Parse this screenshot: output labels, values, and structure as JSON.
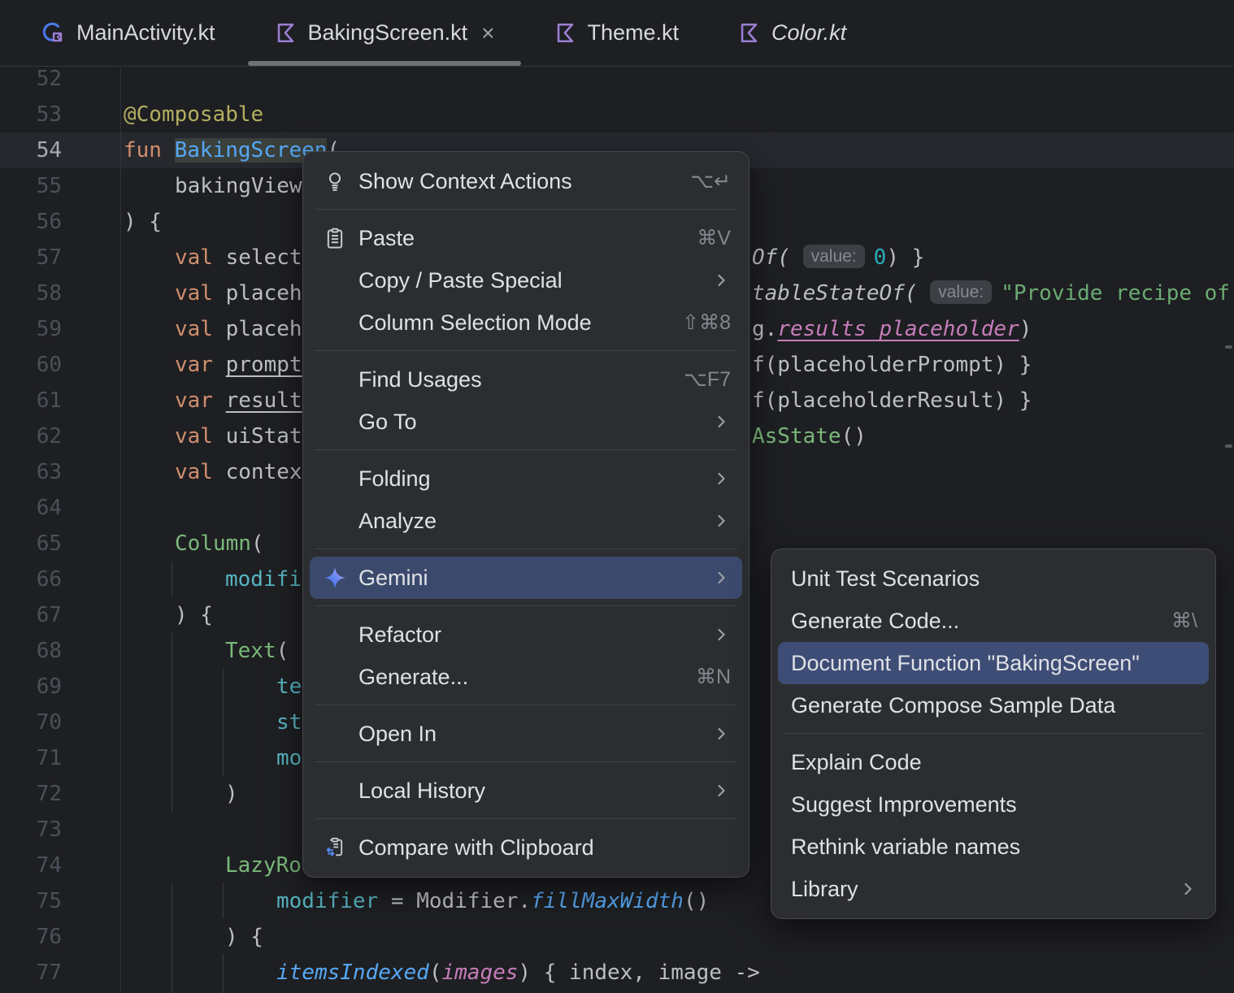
{
  "tabs": [
    {
      "label": "MainActivity.kt",
      "icon": "compose-activity-icon",
      "active": false,
      "italic": false
    },
    {
      "label": "BakingScreen.kt",
      "icon": "kotlin-icon",
      "active": true,
      "italic": false,
      "close_label": "×"
    },
    {
      "label": "Theme.kt",
      "icon": "kotlin-icon",
      "active": false,
      "italic": false
    },
    {
      "label": "Color.kt",
      "icon": "kotlin-icon",
      "active": false,
      "italic": true
    }
  ],
  "editor": {
    "lines": [
      {
        "n": 52,
        "ind": 0,
        "left": []
      },
      {
        "n": 53,
        "ind": 0,
        "left": [
          {
            "t": "@Composable",
            "c": "ann"
          }
        ]
      },
      {
        "n": 54,
        "ind": 0,
        "current": true,
        "left": [
          {
            "t": "fun ",
            "c": "kw"
          },
          {
            "t": "BakingScreen",
            "c": "fn hl"
          },
          {
            "t": "(",
            "c": "pl"
          }
        ]
      },
      {
        "n": 55,
        "ind": 1,
        "left": [
          {
            "t": "bakingView",
            "c": "pl"
          }
        ]
      },
      {
        "n": 56,
        "ind": 0,
        "left": [
          {
            "t": ") {",
            "c": "pl"
          }
        ]
      },
      {
        "n": 57,
        "ind": 1,
        "left": [
          {
            "t": "val ",
            "c": "kw"
          },
          {
            "t": "select",
            "c": "pl"
          }
        ],
        "right": [
          {
            "t": "Of( ",
            "c": "it"
          },
          {
            "t": "value:",
            "c": "pill"
          },
          {
            "t": "0",
            "c": "num"
          },
          {
            "t": ") }",
            "c": "pl"
          }
        ]
      },
      {
        "n": 58,
        "ind": 1,
        "left": [
          {
            "t": "val ",
            "c": "kw"
          },
          {
            "t": "placeh",
            "c": "pl"
          }
        ],
        "right": [
          {
            "t": "tableStateOf( ",
            "c": "it"
          },
          {
            "t": "value:",
            "c": "pill"
          },
          {
            "t": "\"Provide recipe of",
            "c": "str"
          }
        ]
      },
      {
        "n": 59,
        "ind": 1,
        "left": [
          {
            "t": "val ",
            "c": "kw"
          },
          {
            "t": "placeh",
            "c": "pl"
          }
        ],
        "right": [
          {
            "t": "g.",
            "c": "pl"
          },
          {
            "t": "results_placeholder",
            "c": "pinki und"
          },
          {
            "t": ")",
            "c": "pl"
          }
        ]
      },
      {
        "n": 60,
        "ind": 1,
        "left": [
          {
            "t": "var ",
            "c": "kw"
          },
          {
            "t": "prompt",
            "c": "pl und"
          }
        ],
        "right": [
          {
            "t": "f(placeholderPrompt) }",
            "c": "pl"
          }
        ]
      },
      {
        "n": 61,
        "ind": 1,
        "left": [
          {
            "t": "var ",
            "c": "kw"
          },
          {
            "t": "result",
            "c": "pl und"
          }
        ],
        "right": [
          {
            "t": "f(placeholderResult) }",
            "c": "pl"
          }
        ]
      },
      {
        "n": 62,
        "ind": 1,
        "left": [
          {
            "t": "val ",
            "c": "kw"
          },
          {
            "t": "uiStat",
            "c": "pl"
          }
        ],
        "right": [
          {
            "t": "AsState",
            "c": "green"
          },
          {
            "t": "()",
            "c": "pl"
          }
        ]
      },
      {
        "n": 63,
        "ind": 1,
        "left": [
          {
            "t": "val ",
            "c": "kw"
          },
          {
            "t": "contex",
            "c": "pl"
          }
        ]
      },
      {
        "n": 64,
        "ind": 0,
        "left": []
      },
      {
        "n": 65,
        "ind": 1,
        "left": [
          {
            "t": "Column",
            "c": "green"
          },
          {
            "t": "(",
            "c": "pl"
          }
        ]
      },
      {
        "n": 66,
        "ind": 2,
        "left": [
          {
            "t": "modifi",
            "c": "teal"
          }
        ]
      },
      {
        "n": 67,
        "ind": 1,
        "left": [
          {
            "t": ") {",
            "c": "pl"
          }
        ]
      },
      {
        "n": 68,
        "ind": 2,
        "left": [
          {
            "t": "Text",
            "c": "green"
          },
          {
            "t": "(",
            "c": "pl"
          }
        ]
      },
      {
        "n": 69,
        "ind": 3,
        "left": [
          {
            "t": "te",
            "c": "teal"
          }
        ]
      },
      {
        "n": 70,
        "ind": 3,
        "left": [
          {
            "t": "st",
            "c": "teal"
          }
        ]
      },
      {
        "n": 71,
        "ind": 3,
        "left": [
          {
            "t": "mo",
            "c": "teal"
          }
        ]
      },
      {
        "n": 72,
        "ind": 2,
        "left": [
          {
            "t": ")",
            "c": "pl"
          }
        ]
      },
      {
        "n": 73,
        "ind": 0,
        "left": []
      },
      {
        "n": 74,
        "ind": 2,
        "left": [
          {
            "t": "LazyRo",
            "c": "green"
          }
        ]
      },
      {
        "n": 75,
        "ind": 3,
        "left": [
          {
            "t": "modifier",
            "c": "teal"
          },
          {
            "t": " = ",
            "c": "pl"
          },
          {
            "t": "Modifier.",
            "c": "pl"
          },
          {
            "t": "fillMaxWidth",
            "c": "bluei"
          },
          {
            "t": "()",
            "c": "pl"
          }
        ]
      },
      {
        "n": 76,
        "ind": 2,
        "left": [
          {
            "t": ") {",
            "c": "pl"
          }
        ]
      },
      {
        "n": 77,
        "ind": 3,
        "left": [
          {
            "t": "itemsIndexed",
            "c": "bluei"
          },
          {
            "t": "(",
            "c": "pl"
          },
          {
            "t": "images",
            "c": "pinki"
          },
          {
            "t": ") { index, image ->",
            "c": "pl"
          }
        ]
      }
    ]
  },
  "menu": {
    "items": [
      {
        "label": "Show Context Actions",
        "icon": "lightbulb-icon",
        "shortcut": "⌥↵"
      },
      {
        "type": "separator"
      },
      {
        "label": "Paste",
        "icon": "clipboard-icon",
        "shortcut": "⌘V"
      },
      {
        "label": "Copy / Paste Special",
        "arrow": true
      },
      {
        "label": "Column Selection Mode",
        "shortcut": "⇧⌘8"
      },
      {
        "type": "separator"
      },
      {
        "label": "Find Usages",
        "shortcut": "⌥F7"
      },
      {
        "label": "Go To",
        "arrow": true
      },
      {
        "type": "separator"
      },
      {
        "label": "Folding",
        "arrow": true
      },
      {
        "label": "Analyze",
        "arrow": true
      },
      {
        "type": "separator"
      },
      {
        "label": "Gemini",
        "icon": "gemini-icon",
        "arrow": true,
        "selected": true
      },
      {
        "type": "separator"
      },
      {
        "label": "Refactor",
        "arrow": true
      },
      {
        "label": "Generate...",
        "shortcut": "⌘N"
      },
      {
        "type": "separator"
      },
      {
        "label": "Open In",
        "arrow": true
      },
      {
        "type": "separator"
      },
      {
        "label": "Local History",
        "arrow": true
      },
      {
        "type": "separator"
      },
      {
        "label": "Compare with Clipboard",
        "icon": "compare-clipboard-icon"
      }
    ]
  },
  "submenu": {
    "items": [
      {
        "label": "Unit Test Scenarios"
      },
      {
        "label": "Generate Code...",
        "shortcut": "⌘\\"
      },
      {
        "label": "Document Function \"BakingScreen\"",
        "selected": true
      },
      {
        "label": "Generate Compose Sample Data"
      },
      {
        "type": "separator"
      },
      {
        "label": "Explain Code"
      },
      {
        "label": "Suggest Improvements"
      },
      {
        "label": "Rethink variable names"
      },
      {
        "label": "Library",
        "arrow": true
      }
    ]
  },
  "colors": {
    "editor_bg": "#1e1f22",
    "menu_bg": "#2b2d30",
    "menu_selection": "#3b4a6c",
    "submenu_selection": "#3e4d76",
    "keyword": "#cf8e6d",
    "function": "#56a8f5",
    "composable": "#7ab87a",
    "string": "#6aab73",
    "annotation": "#b3ae60",
    "kotlin_icon_purple": "#9b7fd4",
    "gemini_star_blue": "#4285f4",
    "gemini_star_purple": "#9b72cb"
  }
}
